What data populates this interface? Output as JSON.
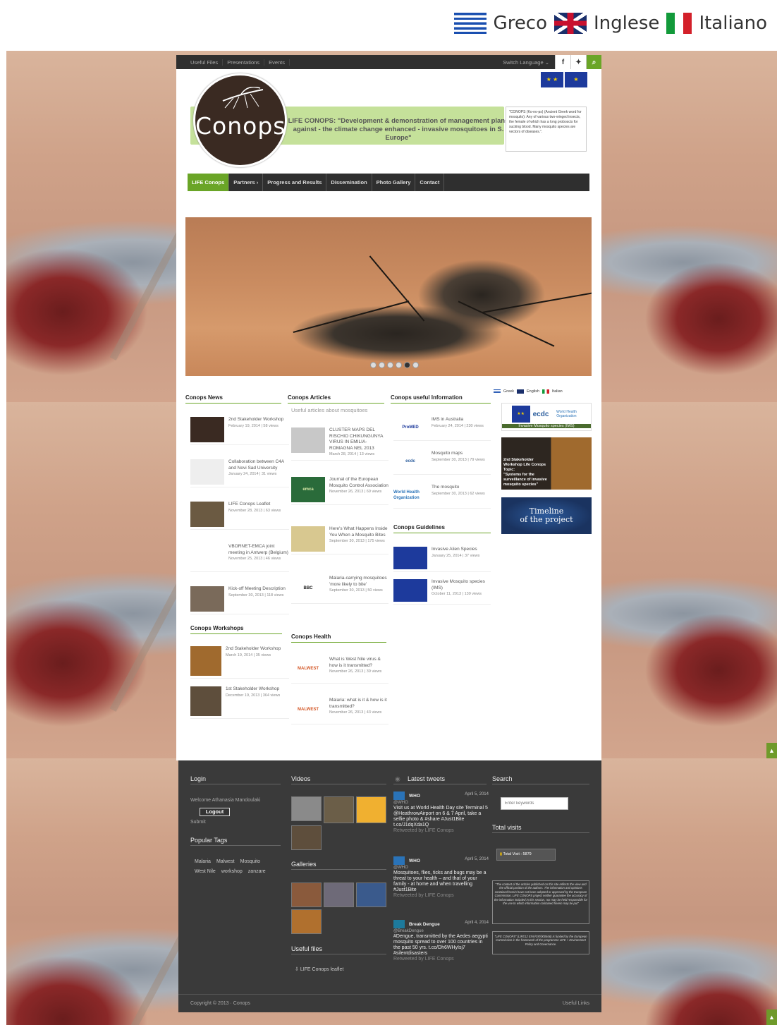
{
  "languages": [
    {
      "label": "Greco",
      "flag": "greece-flag"
    },
    {
      "label": "Inglese",
      "flag": "uk-flag"
    },
    {
      "label": "Italiano",
      "flag": "italy-flag"
    }
  ],
  "topnav": {
    "items": [
      "Useful Files",
      "Presentations",
      "Events"
    ],
    "switch_language": "Switch Language",
    "icons": [
      "facebook-icon",
      "twitter-icon",
      "search-icon"
    ]
  },
  "logo": {
    "word": "Conops"
  },
  "banner": {
    "line1": "LIFE CONOPS: \"Development & demonstration of management plans",
    "line2": "against - the climate change enhanced - invasive mosquitoes in S. Europe\""
  },
  "quote": "\"CONOPS (Ko-no-ps) (Ancient Greek word for mosquito): Any of various two-winged insects, the female of which has a long proboscis for sucking blood. Many mosquito species are vectors of diseases.\".",
  "mainnav": [
    "LIFE Conops",
    "Partners",
    "Progress and Results",
    "Dissemination",
    "Photo Gallery",
    "Contact"
  ],
  "slider": {
    "dot_count": 6,
    "active_dot": 4
  },
  "mini_lang": [
    "Greek",
    "English",
    "Italian"
  ],
  "news": {
    "title": "Conops News",
    "items": [
      {
        "title": "2nd Stakeholder Workshop",
        "meta": "February 19, 2014 | 58 views"
      },
      {
        "title": "Collaboration between C4A and Novi Sad University",
        "meta": "January 24, 2014 | 31 views"
      },
      {
        "title": "LIFE Conops Leaflet",
        "meta": "November 28, 2013 | 63 views"
      },
      {
        "title": "VBORNET-EMCA joint meeting in Antwerp (Belgium)",
        "meta": "November 25, 2013 | 46 views"
      },
      {
        "title": "Kick-off Meeting Description",
        "meta": "September 30, 2013 | 118 views"
      }
    ]
  },
  "workshops": {
    "title": "Conops Workshops",
    "items": [
      {
        "title": "2nd Stakeholder Workshop",
        "meta": "March 19, 2014 | 35 views"
      },
      {
        "title": "1st Stakeholder Workshop",
        "meta": "December 19, 2013 | 364 views"
      }
    ]
  },
  "articles": {
    "title": "Conops Articles",
    "subtitle": "Useful articles about mosquitoes",
    "items": [
      {
        "title": "CLUSTER MAPS DEL RISCHIO CHIKUNGUNYA VIRUS IN EMILIA-ROMAGNA NEL 2013",
        "meta": "March 28, 2014 | 13 views"
      },
      {
        "title": "Journal of the European Mosquito Control Association",
        "meta": "November 26, 2013 | 69 views"
      },
      {
        "title": "Here's What Happens Inside You When a Mosquito Bites",
        "meta": "September 30, 2013 | 175 views"
      },
      {
        "title": "Malaria-carrying mosquitoes 'more likely to bite'",
        "meta": "September 30, 2013 | 50 views"
      }
    ],
    "thumb_labels": [
      "",
      "emca",
      "",
      "BBC"
    ]
  },
  "health": {
    "title": "Conops Health",
    "items": [
      {
        "title": "What is West Nile virus & how is it transmitted?",
        "meta": "November 26, 2013 | 39 views"
      },
      {
        "title": "Malaria: what is it & how is it transmitted?",
        "meta": "November 26, 2013 | 43 views"
      }
    ],
    "thumb_label": "MALWEST"
  },
  "info": {
    "title": "Conops useful Information",
    "items": [
      {
        "title": "IMS in Australia",
        "meta": "February 24, 2014 | 230 views"
      },
      {
        "title": "Mosquito maps",
        "meta": "September 30, 2013 | 79 views"
      },
      {
        "title": "The mosquito",
        "meta": "September 30, 2013 | 62 views"
      }
    ],
    "thumb_labels": [
      "ProMED",
      "ecdc",
      "World Health Organization"
    ]
  },
  "guidelines": {
    "title": "Conops Guidelines",
    "items": [
      {
        "title": "Invasive Alien Species",
        "meta": "January 25, 2014 | 37 views"
      },
      {
        "title": "Invasive Mosquito species (IMS)",
        "meta": "October 11, 2013 | 139 views"
      }
    ]
  },
  "sidebar": {
    "ims_caption": "Invasive Mosquito species (IMS)",
    "ecdc": "ecdc",
    "who": "World Health Organization",
    "workshop_title": "2nd Stakeholder Workshop Life Conops Topic:",
    "workshop_topic": "\"Systems for the surveillance of invasive mosquito species\"",
    "timeline_line1": "Timeline",
    "timeline_line2": "of the project"
  },
  "footer": {
    "login": {
      "title": "Login",
      "welcome": "Welcome Athanasia Mandoulaki",
      "logout": "Logout",
      "submit": "Submit"
    },
    "popular_tags": {
      "title": "Popular Tags",
      "tags": [
        "Malaria",
        "Malwest",
        "Mosquito",
        "West Nile",
        "workshop",
        "zanzare"
      ]
    },
    "videos": {
      "title": "Videos"
    },
    "galleries": {
      "title": "Galleries"
    },
    "useful_files": {
      "title": "Useful files",
      "items": [
        "LIFE Conops leaflet"
      ]
    },
    "tweets": {
      "title": "Latest tweets",
      "items": [
        {
          "name": "WHO",
          "handle": "@WHO",
          "date": "April 5, 2014",
          "text": "Visit us at World Health Day site Terminal 5 @HeathrowAirport on 6 & 7 April, take a selfie photo & #share #Just1Bite t.co/J1dqXda1Q",
          "rt": "Retweeted by LIFE Conops"
        },
        {
          "name": "WHO",
          "handle": "@WHO",
          "date": "April 5, 2014",
          "text": "Mosquitoes, flies, ticks and bugs may be a threat to your health – and that of your family - at home and when travelling #Just1Bite",
          "rt": "Retweeted by LIFE Conops"
        },
        {
          "name": "Break Dengue",
          "handle": "@BreakDengue",
          "date": "April 4, 2014",
          "text": "#Dengue, transmitted by the Aedes aegypti mosquito spread to over 100 countries in the past 50 yrs. t.co/Dh6WHyIsj7 #silentdisasters",
          "rt": "Retweeted by LIFE Conops"
        }
      ]
    },
    "search": {
      "title": "Search",
      "placeholder": "Enter keywords"
    },
    "visits": {
      "title": "Total visits",
      "label": "Total Visit : 5879"
    },
    "disclaimer1": "\"The content of the articles published on this site reflects the view and the official position of the authors. The information and opinions contained herein have not been adopted or approved by the European Commission. LIFE CONOPS project neither guarantee the accuracy of the information included in this section, nor may be held responsible for the use to which information contained herein may be put\"",
    "disclaimer2": "\"LIFE CONOPS\" (LIFE12 ENV/GR/000466) is funded by the European Commission in the framework of the programme LIFE + Environment Policy and Governance.",
    "copyright": "Copyright © 2013 · Conops",
    "useful_links": "Useful Links"
  },
  "colors": {
    "accent": "#6aa527",
    "nav_dark": "#2f2f2f",
    "footer_bg": "#3a3a3a",
    "banner_green": "#c5e19a"
  }
}
